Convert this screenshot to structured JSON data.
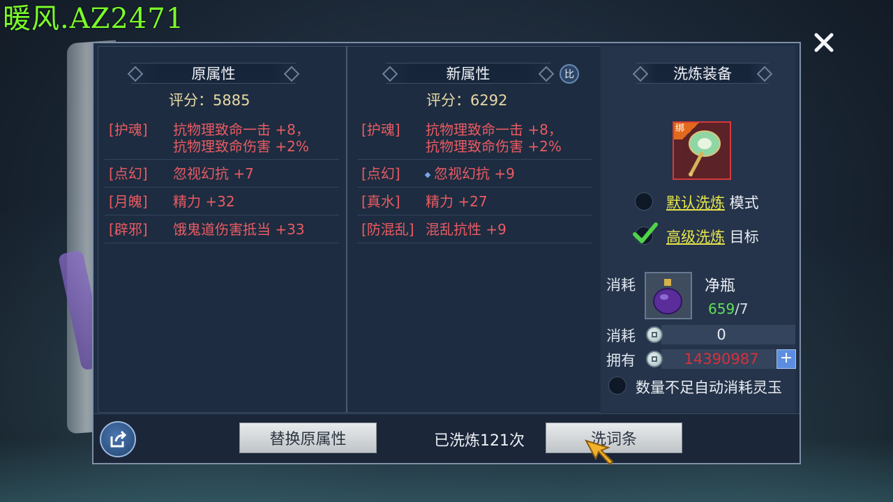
{
  "watermark": "暖风.AZ2471",
  "left_col": {
    "title": "原属性",
    "score": "评分：5885",
    "rows": [
      {
        "tag": "[护魂]",
        "line1": "抗物理致命一击 +8，",
        "line2": "抗物理致命伤害 +2%"
      },
      {
        "tag": "[点幻]",
        "line1": "忽视幻抗 +7"
      },
      {
        "tag": "[月魄]",
        "line1": "精力 +32"
      },
      {
        "tag": "[辟邪]",
        "line1": "饿鬼道伤害抵当 +33"
      }
    ]
  },
  "mid_col": {
    "title": "新属性",
    "compare_label": "比",
    "score": "评分：6292",
    "rows": [
      {
        "tag": "[护魂]",
        "line1": "抗物理致命一击 +8，",
        "line2": "抗物理致命伤害 +2%"
      },
      {
        "tag": "[点幻]",
        "line1": "忽视幻抗 +9"
      },
      {
        "tag": "[真水]",
        "line1": "精力 +27"
      },
      {
        "tag": "[防混乱]",
        "line1": "混乱抗性 +9"
      }
    ]
  },
  "right_col": {
    "title": "洗炼装备",
    "bind_label": "绑",
    "option_default": {
      "link": "默认洗炼",
      "suffix": " 模式"
    },
    "option_advanced": {
      "link": "高级洗炼",
      "suffix": " 目标"
    },
    "consume_label": "消耗",
    "item_name": "净瓶",
    "item_have": "659",
    "item_need": "/7",
    "consume2_label": "消耗",
    "consume2_value": "0",
    "own_label": "拥有",
    "own_value": "14390987",
    "plus_label": "+",
    "auto_text": "数量不足自动消耗灵玉"
  },
  "bottom": {
    "replace_button": "替换原属性",
    "times_text": "已洗炼121次",
    "wash_button": "洗词条"
  },
  "colors": {
    "attr_red": "#ea5b63",
    "score_gold": "#e8d9a6",
    "link_yellow": "#e9e64a",
    "own_red": "#d8303a",
    "have_green": "#5fe05a"
  }
}
